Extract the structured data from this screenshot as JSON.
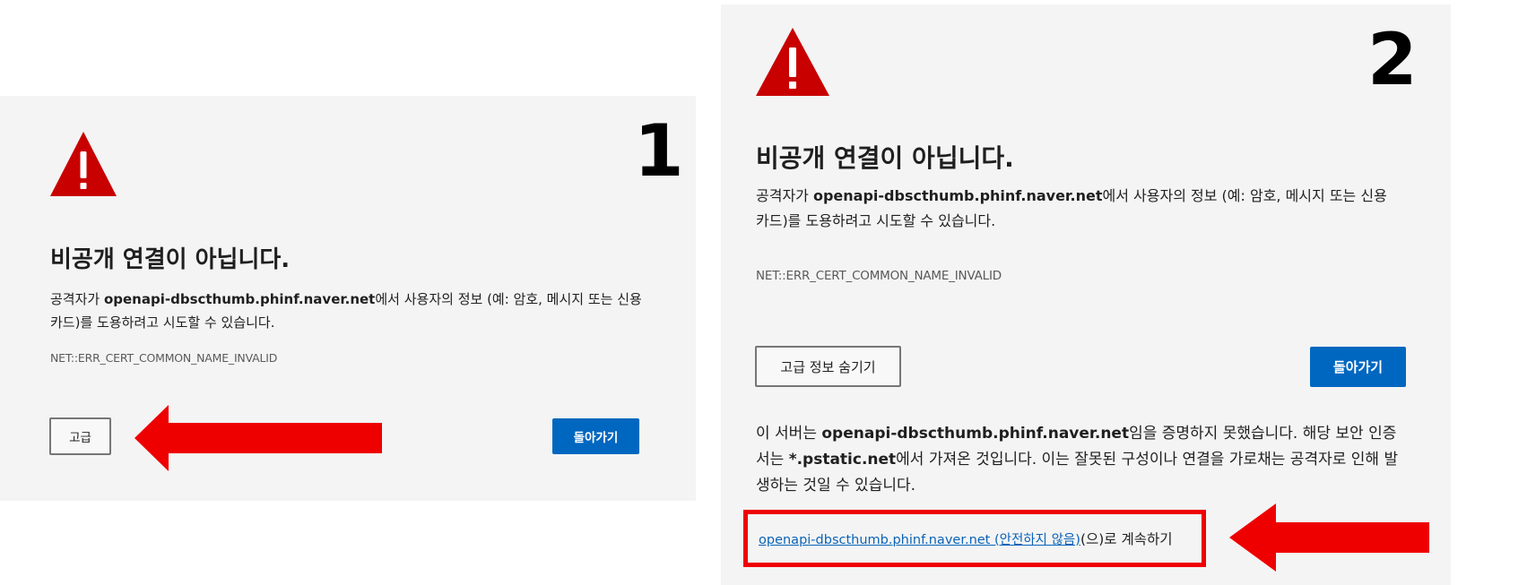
{
  "panel1": {
    "step_number": "1",
    "icon": "warning-triangle-icon",
    "title": "비공개 연결이 아닙니다.",
    "desc_prefix": "공격자가 ",
    "desc_host": "openapi-dbscthumb.phinf.naver.net",
    "desc_suffix": "에서 사용자의 정보 (예: 암호, 메시지 또는 신용 카드)를 도용하려고 시도할 수 있습니다.",
    "error_code": "NET::ERR_CERT_COMMON_NAME_INVALID",
    "advanced_button": "고급",
    "back_button": "돌아가기"
  },
  "panel2": {
    "step_number": "2",
    "icon": "warning-triangle-icon",
    "title": "비공개 연결이 아닙니다.",
    "desc_prefix": "공격자가 ",
    "desc_host": "openapi-dbscthumb.phinf.naver.net",
    "desc_suffix": "에서 사용자의 정보 (예: 암호, 메시지 또는 신용 카드)를 도용하려고 시도할 수 있습니다.",
    "error_code": "NET::ERR_CERT_COMMON_NAME_INVALID",
    "hide_advanced_button": "고급 정보 숨기기",
    "back_button": "돌아가기",
    "detail_prefix": "이 서버는 ",
    "detail_host": "openapi-dbscthumb.phinf.naver.net",
    "detail_mid1": "임을 증명하지 못했습니다. 해당 보안 인증서는 ",
    "detail_cert": "*.pstatic.net",
    "detail_mid2": "에서 가져온 것입니다. 이는 잘못된 구성이나 연결을 가로채는 공격자로 인해 발생하는 것일 수 있습니다.",
    "proceed_link": "openapi-dbscthumb.phinf.naver.net (안전하지 않음)",
    "proceed_suffix": "(으)로 계속하기"
  },
  "colors": {
    "warning_red": "#c80000",
    "annotation_red": "#ef0000",
    "primary_blue": "#0067c0",
    "link_blue": "#0b63b8",
    "panel_bg": "#f4f4f4"
  }
}
